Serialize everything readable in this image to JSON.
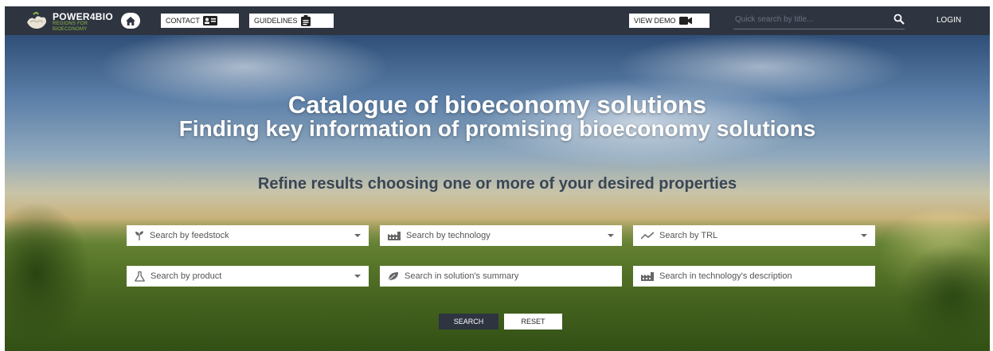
{
  "header": {
    "logo_title": "POWER4BIO",
    "logo_subtitle_line1": "REGIONS FOR",
    "logo_subtitle_line2": "BIOECONOMY",
    "nav": {
      "contact": "CONTACT",
      "guidelines": "GUIDELINES",
      "view_demo": "VIEW DEMO"
    },
    "quick_search_placeholder": "Quick search by title...",
    "login": "LOGIN"
  },
  "hero": {
    "title": "Catalogue of bioeconomy solutions",
    "subtitle": "Finding key information of promising bioeconomy solutions",
    "refine": "Refine results choosing one or more of your desired properties"
  },
  "filters": {
    "feedstock": "Search by feedstock",
    "technology": "Search by technology",
    "trl": "Search by TRL",
    "product": "Search by product",
    "summary": "Search in solution's summary",
    "description": "Search in technology's description"
  },
  "actions": {
    "search": "SEARCH",
    "reset": "RESET"
  },
  "icons": {
    "home": "home-icon",
    "contact": "contact-card-icon",
    "guidelines": "clipboard-icon",
    "demo": "video-camera-icon",
    "search": "search-icon",
    "feedstock": "seedling-icon",
    "technology": "factory-icon",
    "trl": "trend-line-icon",
    "product": "flask-icon",
    "summary": "leaf-icon",
    "description": "factory-icon"
  },
  "colors": {
    "topbar": "#2e3440",
    "brand_green": "#8dbb45",
    "search_button": "#2e3440"
  }
}
